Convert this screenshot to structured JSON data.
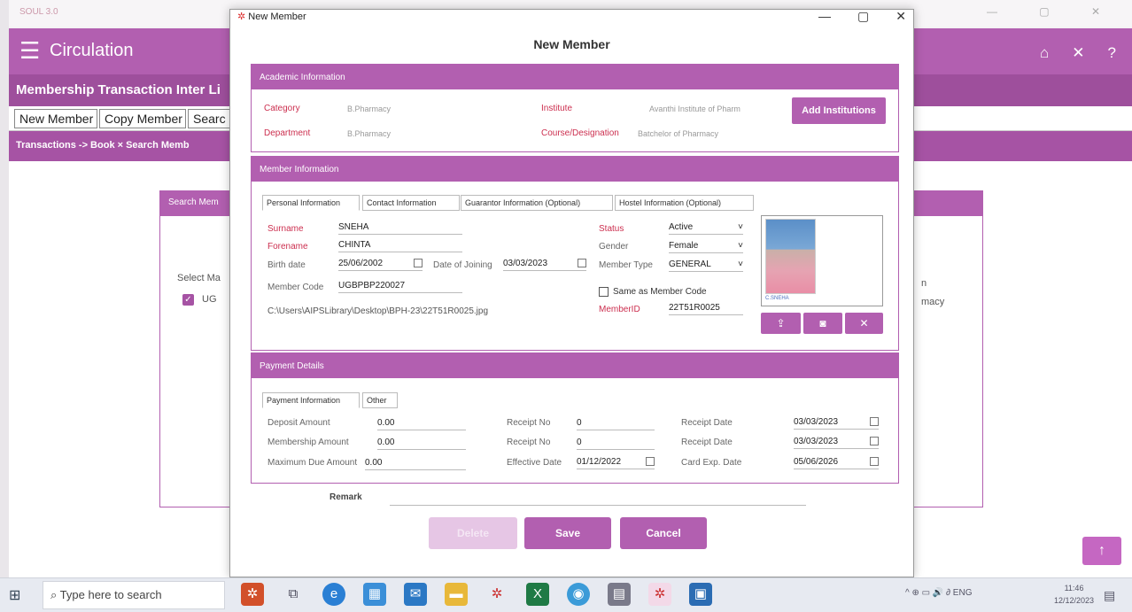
{
  "bg_app": {
    "window_title": "SOUL 3.0",
    "header_title": "Circulation",
    "menu": "Membership  Transaction  Inter Li",
    "tabs": [
      "New Member",
      "Copy Member",
      "Searc"
    ],
    "breadcrumb": "Transactions ->      Book      ×  Search Memb",
    "search_panel_title": "Search Mem",
    "col_select": "Select  Ma",
    "row_value": "UG",
    "right_text_n": "n",
    "right_text": "macy"
  },
  "dialog": {
    "window_title": "New Member",
    "heading": "New Member",
    "academic": {
      "title": "Academic Information",
      "category_label": "Category",
      "category_value": "B.Pharmacy",
      "institute_label": "Institute",
      "institute_value": "Avanthi Institute of Pharm",
      "department_label": "Department",
      "department_value": "B.Pharmacy",
      "course_label": "Course/Designation",
      "course_value": "Batchelor of Pharmacy",
      "add_button": "Add Institutions"
    },
    "member": {
      "title": "Member Information",
      "tabs": [
        "Personal Information",
        "Contact Information",
        "Guarantor Information (Optional)",
        "Hostel Information (Optional)"
      ],
      "surname_label": "Surname",
      "surname": "SNEHA",
      "forename_label": "Forename",
      "forename": "CHINTA",
      "birth_label": "Birth date",
      "birth": "25/06/2002",
      "joining_label": "Date of Joining",
      "joining": "03/03/2023",
      "code_label": "Member Code",
      "code": "UGBPBP220027",
      "photo_path": "C:\\Users\\AIPSLibrary\\Desktop\\BPH-23\\22T51R0025.jpg",
      "status_label": "Status",
      "status": "Active",
      "gender_label": "Gender",
      "gender": "Female",
      "type_label": "Member Type",
      "type": "GENERAL",
      "same_label": "Same as Member Code",
      "memberid_label": "MemberID",
      "memberid": "22T51R0025",
      "photo_caption": "C.SNEHA"
    },
    "payment": {
      "title": "Payment Details",
      "tabs": [
        "Payment Information",
        "Other"
      ],
      "deposit_label": "Deposit Amount",
      "deposit": "0.00",
      "membership_label": "Membership Amount",
      "membership": "0.00",
      "maxdue_label": "Maximum Due Amount",
      "maxdue": "0.00",
      "receipt1_label": "Receipt No",
      "receipt1": "0",
      "receipt2_label": "Receipt No",
      "receipt2": "0",
      "effective_label": "Effective Date",
      "effective": "01/12/2022",
      "rdate1_label": "Receipt Date",
      "rdate1": "03/03/2023",
      "rdate2_label": "Receipt Date",
      "rdate2": "03/03/2023",
      "cardexp_label": "Card Exp. Date",
      "cardexp": "05/06/2026"
    },
    "remark_label": "Remark",
    "buttons": {
      "delete": "Delete",
      "save": "Save",
      "cancel": "Cancel"
    }
  },
  "taskbar": {
    "search_placeholder": "Type here to search",
    "tray": "^  ⊕  ▭  🔊  ∂  ENG",
    "time": "11:46",
    "date": "12/12/2023"
  },
  "colors": {
    "accent": "#b25fb0",
    "accent_dark": "#9e4f9c",
    "required_label": "#cc2f4f"
  }
}
